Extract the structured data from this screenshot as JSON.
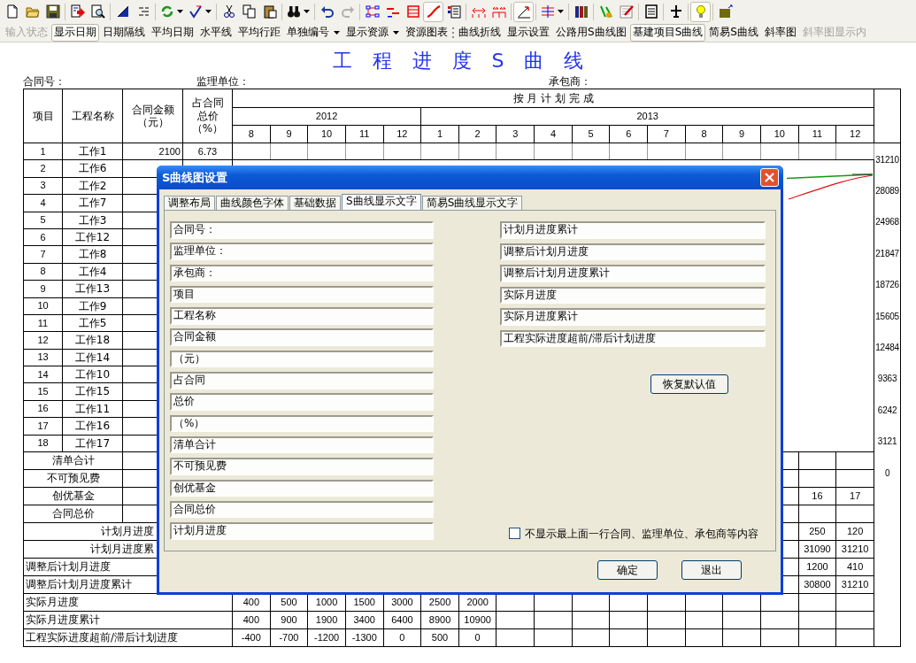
{
  "toolbar": {
    "icons": [
      {
        "kind": "new",
        "pressed": false,
        "disabled": false,
        "dropdown": false
      },
      {
        "kind": "open",
        "pressed": false,
        "disabled": false,
        "dropdown": false
      },
      {
        "kind": "save",
        "pressed": false,
        "disabled": false,
        "dropdown": false
      },
      {
        "kind": "separator"
      },
      {
        "kind": "export",
        "pressed": false,
        "disabled": false,
        "dropdown": false
      },
      {
        "kind": "preview",
        "pressed": false,
        "disabled": false,
        "dropdown": false
      },
      {
        "kind": "separator"
      },
      {
        "kind": "wedge",
        "pressed": false,
        "disabled": false,
        "dropdown": false
      },
      {
        "kind": "dashes",
        "pressed": false,
        "disabled": false,
        "dropdown": false
      },
      {
        "kind": "separator"
      },
      {
        "kind": "refresh",
        "pressed": false,
        "disabled": false,
        "dropdown": true
      },
      {
        "kind": "check",
        "pressed": false,
        "disabled": false,
        "dropdown": true
      },
      {
        "kind": "separator"
      },
      {
        "kind": "cut",
        "pressed": false,
        "disabled": false,
        "dropdown": false
      },
      {
        "kind": "copy",
        "pressed": false,
        "disabled": false,
        "dropdown": false
      },
      {
        "kind": "paste",
        "pressed": false,
        "disabled": false,
        "dropdown": false
      },
      {
        "kind": "separator"
      },
      {
        "kind": "find",
        "pressed": false,
        "disabled": false,
        "dropdown": true
      },
      {
        "kind": "separator"
      },
      {
        "kind": "undo",
        "pressed": false,
        "disabled": false,
        "dropdown": false
      },
      {
        "kind": "redo",
        "pressed": false,
        "disabled": true,
        "dropdown": false
      },
      {
        "kind": "separator"
      },
      {
        "kind": "network",
        "pressed": false,
        "disabled": false,
        "dropdown": false
      },
      {
        "kind": "bars",
        "pressed": false,
        "disabled": false,
        "dropdown": false
      },
      {
        "kind": "frame",
        "pressed": false,
        "disabled": false,
        "dropdown": false
      },
      {
        "kind": "curve",
        "pressed": true,
        "disabled": false,
        "dropdown": false
      },
      {
        "kind": "report",
        "pressed": false,
        "disabled": false,
        "dropdown": false
      },
      {
        "kind": "separator"
      },
      {
        "kind": "span",
        "pressed": false,
        "disabled": false,
        "dropdown": false
      },
      {
        "kind": "span2",
        "pressed": false,
        "disabled": false,
        "dropdown": false
      },
      {
        "kind": "separator"
      },
      {
        "kind": "slope",
        "pressed": true,
        "disabled": false,
        "dropdown": false
      },
      {
        "kind": "separator"
      },
      {
        "kind": "levels",
        "pressed": false,
        "disabled": false,
        "dropdown": true
      },
      {
        "kind": "separator"
      },
      {
        "kind": "books",
        "pressed": false,
        "disabled": false,
        "dropdown": false
      },
      {
        "kind": "separator"
      },
      {
        "kind": "tool",
        "pressed": false,
        "disabled": false,
        "dropdown": false
      },
      {
        "kind": "memo",
        "pressed": false,
        "disabled": false,
        "dropdown": false
      },
      {
        "kind": "separator"
      },
      {
        "kind": "notebook",
        "pressed": false,
        "disabled": false,
        "dropdown": false
      },
      {
        "kind": "separator"
      },
      {
        "kind": "plane",
        "pressed": false,
        "disabled": false,
        "dropdown": false
      },
      {
        "kind": "separator"
      },
      {
        "kind": "bulb",
        "pressed": true,
        "disabled": false,
        "dropdown": false
      },
      {
        "kind": "separator"
      },
      {
        "kind": "folder",
        "pressed": false,
        "disabled": false,
        "dropdown": false
      }
    ],
    "buttons": [
      {
        "kind": "button",
        "label": "输入状态",
        "pressed": false,
        "disabled": true,
        "dropdown": false
      },
      {
        "kind": "button",
        "label": "显示日期",
        "pressed": true,
        "disabled": false,
        "dropdown": false
      },
      {
        "kind": "button",
        "label": "日期隔线",
        "pressed": false,
        "disabled": false,
        "dropdown": false
      },
      {
        "kind": "button",
        "label": "平均日期",
        "pressed": false,
        "disabled": false,
        "dropdown": false
      },
      {
        "kind": "button",
        "label": "水平线",
        "pressed": false,
        "disabled": false,
        "dropdown": false
      },
      {
        "kind": "button",
        "label": "平均行距",
        "pressed": false,
        "disabled": false,
        "dropdown": false
      },
      {
        "kind": "button",
        "label": "单独编号",
        "pressed": false,
        "disabled": false,
        "dropdown": true
      },
      {
        "kind": "button",
        "label": "显示资源",
        "pressed": false,
        "disabled": false,
        "dropdown": true
      },
      {
        "kind": "button",
        "label": "资源图表",
        "pressed": false,
        "disabled": false,
        "dropdown": false
      },
      {
        "kind": "grip"
      },
      {
        "kind": "button",
        "label": "曲线折线",
        "pressed": false,
        "disabled": false,
        "dropdown": false
      },
      {
        "kind": "button",
        "label": "显示设置",
        "pressed": false,
        "disabled": false,
        "dropdown": false
      },
      {
        "kind": "button",
        "label": "公路用S曲线图",
        "pressed": false,
        "disabled": false,
        "dropdown": false
      },
      {
        "kind": "button",
        "label": "基建项目S曲线",
        "pressed": true,
        "disabled": false,
        "dropdown": false
      },
      {
        "kind": "button",
        "label": "简易S曲线",
        "pressed": false,
        "disabled": false,
        "dropdown": false
      },
      {
        "kind": "button",
        "label": "斜率图",
        "pressed": false,
        "disabled": false,
        "dropdown": false
      },
      {
        "kind": "button",
        "label": "斜率图显示内",
        "pressed": false,
        "disabled": true,
        "dropdown": false
      }
    ]
  },
  "report": {
    "title": "工 程 进 度 S 曲 线",
    "header_fields": [
      "合同号：",
      "监理单位：",
      "承包商："
    ],
    "table": {
      "columns": [
        {
          "lines": [
            "项目"
          ]
        },
        {
          "lines": [
            "工程名称"
          ]
        },
        {
          "lines": [
            "合同金额",
            "（元）"
          ]
        },
        {
          "lines": [
            "占合同",
            "总价",
            "（%）"
          ]
        }
      ],
      "month_group": "按 月 计 划 完 成",
      "years": [
        {
          "label": "2012",
          "months": [
            "8",
            "9",
            "10",
            "11",
            "12"
          ]
        },
        {
          "label": "2013",
          "months": [
            "1",
            "2",
            "3",
            "4",
            "5",
            "6",
            "7",
            "8",
            "9",
            "10",
            "11",
            "12"
          ]
        }
      ],
      "rows": [
        {
          "number": "1",
          "name": "工作1",
          "amount": "2100",
          "share": "6.73"
        },
        {
          "number": "2",
          "name": "工作6"
        },
        {
          "number": "3",
          "name": "工作2"
        },
        {
          "number": "4",
          "name": "工作7"
        },
        {
          "number": "5",
          "name": "工作3"
        },
        {
          "number": "6",
          "name": "工作12"
        },
        {
          "number": "7",
          "name": "工作8"
        },
        {
          "number": "8",
          "name": "工作4"
        },
        {
          "number": "9",
          "name": "工作13"
        },
        {
          "number": "10",
          "name": "工作9"
        },
        {
          "number": "11",
          "name": "工作5"
        },
        {
          "number": "12",
          "name": "工作18"
        },
        {
          "number": "13",
          "name": "工作14"
        },
        {
          "number": "14",
          "name": "工作10"
        },
        {
          "number": "15",
          "name": "工作15"
        },
        {
          "number": "16",
          "name": "工作11"
        },
        {
          "number": "17",
          "name": "工作16"
        },
        {
          "number": "18",
          "name": "工作17"
        }
      ],
      "summary_rows": [
        {
          "label": "清单合计"
        },
        {
          "label": "不可预见费"
        },
        {
          "label": "创优基金",
          "last_months": [
            "16",
            "17"
          ]
        },
        {
          "label": "合同总价"
        }
      ],
      "progress_rows": [
        {
          "kind": "plan",
          "label": "计划月进度",
          "last_months": [
            "250",
            "120"
          ]
        },
        {
          "kind": "plan",
          "label": "计划月进度累",
          "last_months": [
            "31090",
            "31210"
          ]
        },
        {
          "kind": "adjusted",
          "label": "调整后计划月进度",
          "last_months": [
            "1200",
            "410"
          ]
        },
        {
          "kind": "adjusted",
          "label": "调整后计划月进度累计",
          "last_months": [
            "30800",
            "31210"
          ]
        },
        {
          "kind": "actual",
          "label": "实际月进度",
          "first_months": [
            "400",
            "500",
            "1000",
            "1500",
            "3000",
            "2500",
            "2000"
          ]
        },
        {
          "kind": "actual",
          "label": "实际月进度累计",
          "first_months": [
            "400",
            "900",
            "1900",
            "3400",
            "6400",
            "8900",
            "10900"
          ]
        },
        {
          "kind": "actual",
          "label": "工程实际进度超前/滞后计划进度",
          "first_months": [
            "-400",
            "-700",
            "-1200",
            "-1300",
            "0",
            "500",
            "0"
          ]
        }
      ],
      "axis_labels": [
        "31210",
        "28089",
        "24968",
        "21847",
        "18726",
        "15605",
        "12484",
        "9363",
        "6242",
        "3121",
        "0"
      ]
    }
  },
  "dialog": {
    "title": "S曲线图设置",
    "tabs": [
      {
        "label": "调整布局",
        "selected": false
      },
      {
        "label": "曲线颜色字体",
        "selected": false
      },
      {
        "label": "基础数据",
        "selected": false
      },
      {
        "label": "S曲线显示文字",
        "selected": true
      },
      {
        "label": "简易S曲线显示文字",
        "selected": false
      }
    ],
    "left_fields": [
      "合同号：",
      "监理单位：",
      "承包商：",
      "项目",
      "工程名称",
      "合同金额",
      "（元）",
      "占合同",
      "总价",
      "（%）",
      "清单合计",
      "不可预见费",
      "创优基金",
      "合同总价",
      "计划月进度"
    ],
    "right_fields": [
      "计划月进度累计",
      "调整后计划月进度",
      "调整后计划月进度累计",
      "实际月进度",
      "实际月进度累计",
      "工程实际进度超前/滞后计划进度"
    ],
    "restore_button": "恢复默认值",
    "option": {
      "label": "不显示最上面一行合同、监理单位、承包商等内容",
      "checked": false
    },
    "buttons": [
      "确定",
      "退出"
    ]
  }
}
